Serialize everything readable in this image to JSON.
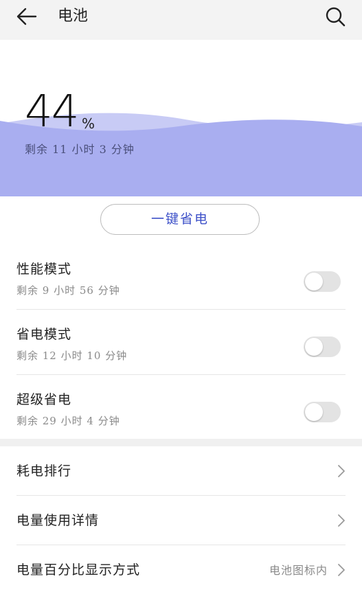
{
  "header": {
    "title": "电池",
    "back_icon": "arrow-left-icon",
    "search_icon": "search-icon"
  },
  "battery": {
    "percent": "44",
    "percent_sign": "%",
    "remaining": "剩余 11 小时 3 分钟",
    "level_fraction": 0.44,
    "wave_color": "#a9aef0"
  },
  "one_key_save": {
    "label": "一键省电",
    "color": "#3d50c8"
  },
  "modes": [
    {
      "title": "性能模式",
      "subtitle": "剩余 9 小时 56 分钟",
      "enabled": false
    },
    {
      "title": "省电模式",
      "subtitle": "剩余 12 小时 10 分钟",
      "enabled": false
    },
    {
      "title": "超级省电",
      "subtitle": "剩余 29 小时 4 分钟",
      "enabled": false
    }
  ],
  "nav_items": [
    {
      "label": "耗电排行",
      "value": ""
    },
    {
      "label": "电量使用详情",
      "value": ""
    },
    {
      "label": "电量百分比显示方式",
      "value": "电池图标内"
    }
  ]
}
